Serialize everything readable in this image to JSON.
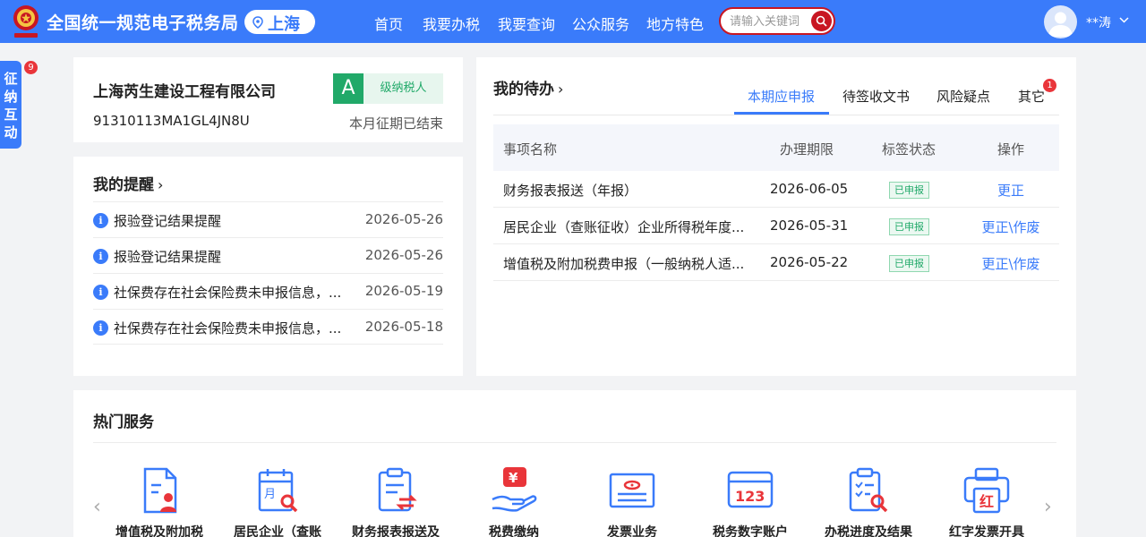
{
  "header": {
    "logo_text": "中国税务",
    "site_title": "全国统一规范电子税务局",
    "location": "上海",
    "nav": [
      "首页",
      "我要办税",
      "我要查询",
      "公众服务",
      "地方特色"
    ],
    "search_placeholder": "请输入关键词",
    "user_name": "**涛",
    "accent_color": "#3a7bfa"
  },
  "side_tab": {
    "chars": [
      "征",
      "纳",
      "互",
      "动"
    ],
    "badge": "9"
  },
  "company": {
    "name": "上海芮生建设工程有限公司",
    "tax_id": "91310113MA1GL4JN8U",
    "grade": "A",
    "grade_type": "级纳税人",
    "period_status": "本月征期已结束"
  },
  "reminders": {
    "title": "我的提醒",
    "items": [
      {
        "text": "报验登记结果提醒",
        "date": "2026-05-26"
      },
      {
        "text": "报验登记结果提醒",
        "date": "2026-05-26"
      },
      {
        "text": "社保费存在社会保险费未申报信息，...",
        "date": "2026-05-19"
      },
      {
        "text": "社保费存在社会保险费未申报信息，...",
        "date": "2026-05-18"
      }
    ]
  },
  "todo": {
    "title": "我的待办",
    "tabs": [
      "本期应申报",
      "待签收文书",
      "风险疑点",
      "其它"
    ],
    "tab_badge": "1",
    "columns": [
      "事项名称",
      "办理期限",
      "标签状态",
      "操作"
    ],
    "rows": [
      {
        "item": "财务报表报送（年报）",
        "deadline": "2026-06-05",
        "status": "已申报",
        "action": "更正"
      },
      {
        "item": "居民企业（查账征收）企业所得税年度...",
        "deadline": "2026-05-31",
        "status": "已申报",
        "action": "更正\\作废"
      },
      {
        "item": "增值税及附加税费申报（一般纳税人适...",
        "deadline": "2026-05-22",
        "status": "已申报",
        "action": "更正\\作废"
      }
    ]
  },
  "hot_services": {
    "title": "热门服务",
    "items": [
      {
        "label": "增值税及附加税",
        "icon": "tax-form-user-icon"
      },
      {
        "label": "居民企业（查账",
        "icon": "calendar-search-icon"
      },
      {
        "label": "财务报表报送及",
        "icon": "report-transfer-icon"
      },
      {
        "label": "税费缴纳",
        "icon": "yuan-hand-icon"
      },
      {
        "label": "发票业务",
        "icon": "invoice-icon"
      },
      {
        "label": "税务数字账户",
        "icon": "digital-account-icon"
      },
      {
        "label": "办税进度及结果",
        "icon": "checklist-search-icon"
      },
      {
        "label": "红字发票开具",
        "icon": "red-invoice-printer-icon"
      }
    ],
    "icon_color": "#3a7bfa",
    "highlight_color": "#e9353a"
  }
}
